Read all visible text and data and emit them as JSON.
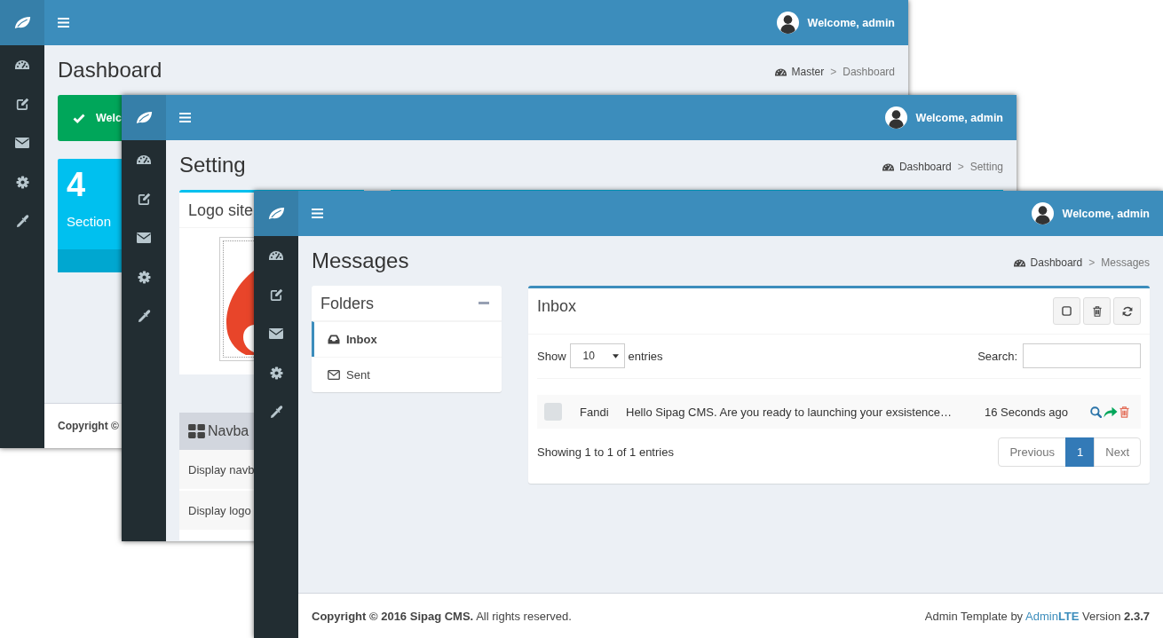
{
  "windows": [
    {
      "kind": "dashboard",
      "header": {
        "user": "Welcome, admin"
      },
      "page_title": "Dashboard",
      "breadcrumb": {
        "home": "Master",
        "separator": ">",
        "current": "Dashboard"
      },
      "callout": {
        "text": "Welc"
      },
      "info_box": {
        "number": "4",
        "label": "Section"
      },
      "footer": {
        "copyright": "Copyright ©"
      }
    },
    {
      "kind": "setting",
      "header": {
        "user": "Welcome, admin"
      },
      "page_title": "Setting",
      "breadcrumb": {
        "home": "Dashboard",
        "separator": ">",
        "current": "Setting"
      },
      "logo_box": {
        "title": "Logo site"
      },
      "navbar_box": {
        "title": "Navba",
        "rows": [
          "Display navb",
          "Display logo"
        ]
      }
    },
    {
      "kind": "messages",
      "header": {
        "user": "Welcome, admin"
      },
      "page_title": "Messages",
      "breadcrumb": {
        "home": "Dashboard",
        "separator": ">",
        "current": "Messages"
      },
      "folders": {
        "title": "Folders",
        "items": [
          {
            "label": "Inbox",
            "selected": true
          },
          {
            "label": "Sent",
            "selected": false
          }
        ]
      },
      "inbox": {
        "title": "Inbox",
        "length_label": "Show",
        "length_value": "10",
        "length_suffix": "entries",
        "search_label": "Search:",
        "rows": [
          {
            "checked": false,
            "sender": "Fandi",
            "subject": "Hello Sipag CMS. Are you ready to launching your exsistence…",
            "time": "16 Seconds ago"
          }
        ],
        "info": "Showing 1 to 1 of 1 entries",
        "pages": [
          {
            "label": "Previous",
            "selected": false
          },
          {
            "label": "1",
            "selected": true
          },
          {
            "label": "Next",
            "selected": false
          }
        ]
      },
      "footer": {
        "copyright": "**Copyright © 2016 Sipag CMS.** All rights reserved.",
        "credit": {
          "before": "Admin Template by",
          "link": "Admin**LTE**",
          "after": "Version **2.3.7**"
        }
      }
    }
  ]
}
